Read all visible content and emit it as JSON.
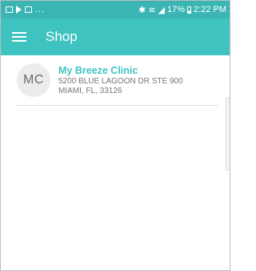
{
  "status_bar": {
    "notification_icons": [
      "image-icon",
      "play-icon",
      "photo-icon"
    ],
    "ellipsis": "...",
    "battery": "17%",
    "time": "2:22 PM"
  },
  "app_bar": {
    "title": "Shop"
  },
  "list": {
    "items": [
      {
        "initials": "MC",
        "name": "My Breeze Clinic",
        "address_line1": "5200 BLUE LAGOON DR STE 900",
        "address_line2": "MIAMI, FL, 33126"
      }
    ]
  },
  "colors": {
    "status_bar": "#3ab5b3",
    "app_bar": "#3fc3c1",
    "accent_text": "#3fc3c1",
    "avatar_bg": "#ececec"
  }
}
